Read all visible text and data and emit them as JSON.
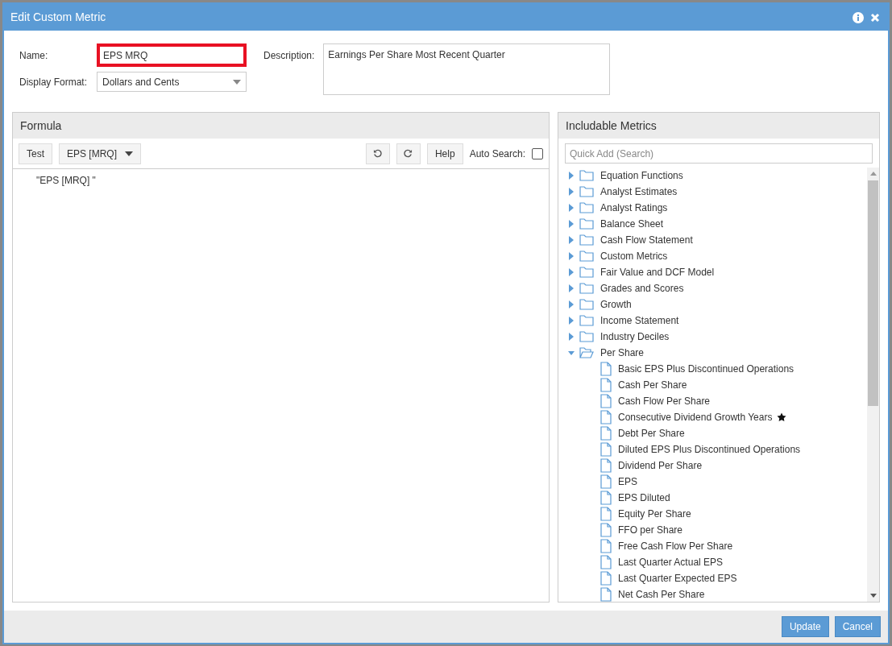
{
  "window": {
    "title": "Edit Custom Metric"
  },
  "form": {
    "name_label": "Name:",
    "name_value": "EPS MRQ",
    "name_highlighted": true,
    "format_label": "Display Format:",
    "format_value": "Dollars and Cents",
    "description_label": "Description:",
    "description_value": "Earnings Per Share Most Recent Quarter"
  },
  "formula": {
    "title": "Formula",
    "toolbar": {
      "test": "Test",
      "metric_select": "EPS [MRQ]",
      "help": "Help",
      "auto_search_label": "Auto Search:",
      "auto_search_checked": false
    },
    "text": "\"EPS [MRQ] \""
  },
  "metrics": {
    "title": "Includable Metrics",
    "search_placeholder": "Quick Add (Search)",
    "tree": [
      {
        "kind": "folder",
        "label": "Equation Functions",
        "expanded": false
      },
      {
        "kind": "folder",
        "label": "Analyst Estimates",
        "expanded": false
      },
      {
        "kind": "folder",
        "label": "Analyst Ratings",
        "expanded": false
      },
      {
        "kind": "folder",
        "label": "Balance Sheet",
        "expanded": false
      },
      {
        "kind": "folder",
        "label": "Cash Flow Statement",
        "expanded": false
      },
      {
        "kind": "folder",
        "label": "Custom Metrics",
        "expanded": false
      },
      {
        "kind": "folder",
        "label": "Fair Value and DCF Model",
        "expanded": false
      },
      {
        "kind": "folder",
        "label": "Grades and Scores",
        "expanded": false
      },
      {
        "kind": "folder",
        "label": "Growth",
        "expanded": false
      },
      {
        "kind": "folder",
        "label": "Income Statement",
        "expanded": false
      },
      {
        "kind": "folder",
        "label": "Industry Deciles",
        "expanded": false
      },
      {
        "kind": "folder",
        "label": "Per Share",
        "expanded": true,
        "children": [
          {
            "kind": "file",
            "label": "Basic EPS Plus Discontinued Operations",
            "starred": false
          },
          {
            "kind": "file",
            "label": "Cash Per Share",
            "starred": false
          },
          {
            "kind": "file",
            "label": "Cash Flow Per Share",
            "starred": false
          },
          {
            "kind": "file",
            "label": "Consecutive Dividend Growth Years",
            "starred": true
          },
          {
            "kind": "file",
            "label": "Debt Per Share",
            "starred": false
          },
          {
            "kind": "file",
            "label": "Diluted EPS Plus Discontinued Operations",
            "starred": false
          },
          {
            "kind": "file",
            "label": "Dividend Per Share",
            "starred": false
          },
          {
            "kind": "file",
            "label": "EPS",
            "starred": false
          },
          {
            "kind": "file",
            "label": "EPS Diluted",
            "starred": false
          },
          {
            "kind": "file",
            "label": "Equity Per Share",
            "starred": false
          },
          {
            "kind": "file",
            "label": "FFO per Share",
            "starred": false
          },
          {
            "kind": "file",
            "label": "Free Cash Flow Per Share",
            "starred": false
          },
          {
            "kind": "file",
            "label": "Last Quarter Actual EPS",
            "starred": false
          },
          {
            "kind": "file",
            "label": "Last Quarter Expected EPS",
            "starred": false
          },
          {
            "kind": "file",
            "label": "Net Cash Per Share",
            "starred": false
          }
        ]
      }
    ]
  },
  "buttons": [
    "Update",
    "Cancel"
  ]
}
